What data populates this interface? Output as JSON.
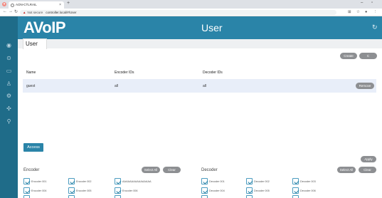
{
  "browser": {
    "tab_title": "AON-CTLRAIL",
    "tab_close": "×",
    "new_tab": "+",
    "address": "controller.local/#/User",
    "security_label": "Not secure",
    "warning_glyph": "▲",
    "win_min": "–",
    "win_max": "▫"
  },
  "header": {
    "logo": "AVoIP",
    "title": "User",
    "refresh_icon": "↻"
  },
  "tabs": {
    "user": "User"
  },
  "toolbar": {
    "create": "Create",
    "second": "C"
  },
  "table": {
    "headers": [
      "Name",
      "Encoder IDs",
      "Decoder IDs"
    ],
    "rows": [
      {
        "name": "guest",
        "encoders": "all",
        "decoders": "all",
        "action": "Remove"
      }
    ]
  },
  "access": {
    "button": "Access",
    "apply": "Apply"
  },
  "encoder": {
    "heading": "Encoder",
    "select_all": "Select All",
    "clear": "Clear",
    "items": [
      "Encoder 001",
      "Encoder 002",
      "AAAAAAAAAAAAAAAA",
      "Encoder 004",
      "Encoder 005",
      "Encoder 006"
    ]
  },
  "decoder": {
    "heading": "Decoder",
    "select_all": "Select All",
    "clear": "Clear",
    "items": [
      "Decoder 001",
      "Decoder 002",
      "Decoder 003",
      "Decoder 004",
      "Decoder 005",
      "Decoder 006"
    ]
  },
  "colors": {
    "header": "#2a84a8",
    "sidebar": "#1f6c89",
    "row_highlight": "#e8eef9",
    "pill": "#8d8f92"
  },
  "icons": {
    "sidebar": [
      "dashboard-icon",
      "monitor-icon",
      "display-icon",
      "user-icon",
      "settings-icon",
      "network-icon",
      "link-icon"
    ]
  }
}
